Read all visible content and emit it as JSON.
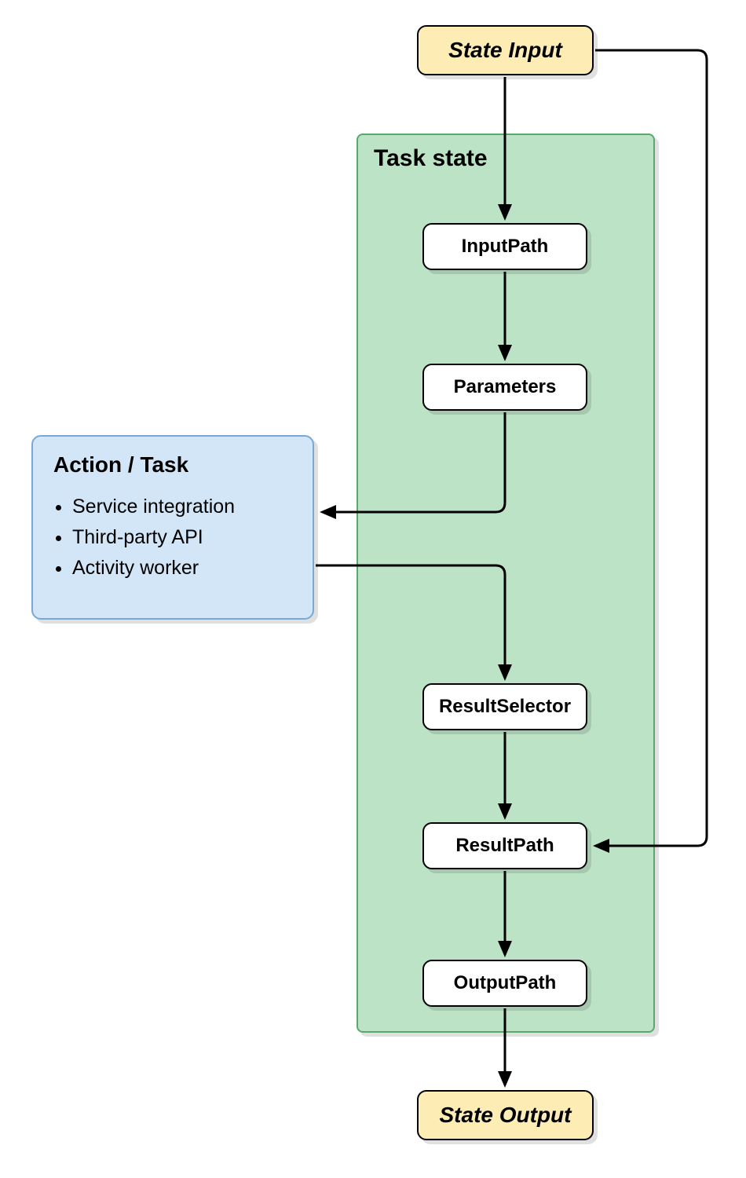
{
  "stateInput": "State Input",
  "stateOutput": "State Output",
  "taskState": {
    "title": "Task state",
    "steps": {
      "inputPath": "InputPath",
      "parameters": "Parameters",
      "resultSelector": "ResultSelector",
      "resultPath": "ResultPath",
      "outputPath": "OutputPath"
    }
  },
  "actionTask": {
    "title": "Action / Task",
    "items": [
      "Service integration",
      "Third-party API",
      "Activity worker"
    ]
  }
}
